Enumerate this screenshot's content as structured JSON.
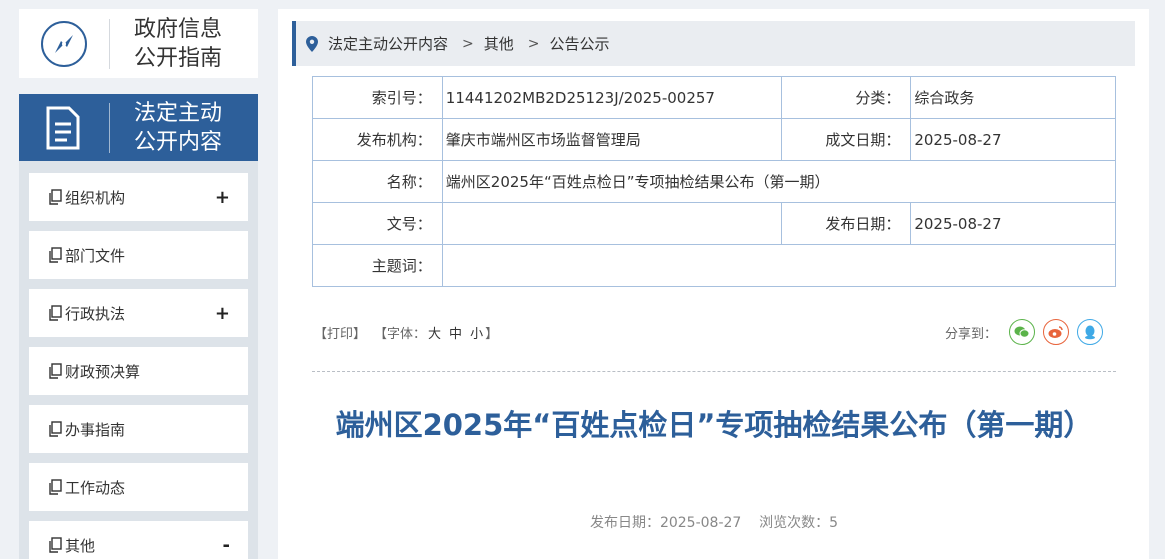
{
  "sidebar": {
    "guide_title": [
      "政府信息",
      "公开指南"
    ],
    "active_title": [
      "法定主动",
      "公开内容"
    ],
    "items": [
      {
        "label": "组织机构",
        "toggle": "+"
      },
      {
        "label": "部门文件",
        "toggle": ""
      },
      {
        "label": "行政执法",
        "toggle": "+"
      },
      {
        "label": "财政预决算",
        "toggle": ""
      },
      {
        "label": "办事指南",
        "toggle": ""
      },
      {
        "label": "工作动态",
        "toggle": ""
      },
      {
        "label": "其他",
        "toggle": "-"
      }
    ]
  },
  "breadcrumb": [
    "法定主动公开内容",
    "其他",
    "公告公示"
  ],
  "meta": {
    "index_label": "索引号：",
    "index_value": "11441202MB2D25123J/2025-00257",
    "category_label": "分类：",
    "category_value": "综合政务",
    "publisher_label": "发布机构：",
    "publisher_value": "肇庆市端州区市场监督管理局",
    "created_label": "成文日期：",
    "created_value": "2025-08-27",
    "name_label": "名称：",
    "name_value": "端州区2025年“百姓点检日”专项抽检结果公布（第一期）",
    "doc_no_label": "文号：",
    "doc_no_value": "",
    "pub_date_label": "发布日期：",
    "pub_date_value": "2025-08-27",
    "keywords_label": "主题词：",
    "keywords_value": ""
  },
  "tools": {
    "print": "【打印】",
    "font_open": "【字体：",
    "font_large": "大",
    "font_medium": "中",
    "font_small": "小",
    "font_close": "】",
    "share_label": "分享到："
  },
  "article": {
    "title": "端州区2025年“百姓点检日”专项抽检结果公布（第一期）",
    "meta_line": "发布日期：2025-08-27    浏览次数：5"
  },
  "colors": {
    "brand": "#2d5f9a",
    "wechat": "#5bb34a",
    "weibo": "#e8643c",
    "qq": "#3fa9e6"
  }
}
